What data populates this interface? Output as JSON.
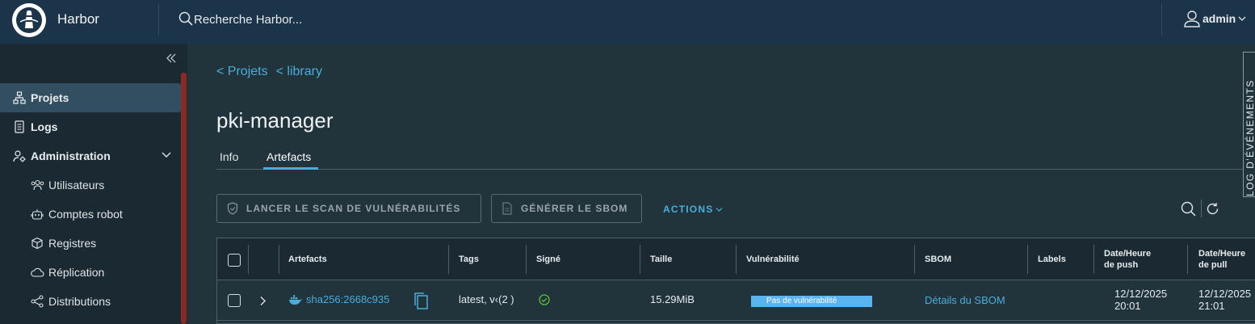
{
  "header": {
    "app_name": "Harbor",
    "search_placeholder": "Recherche Harbor...",
    "user": "admin"
  },
  "sidebar": {
    "items": [
      {
        "label": "Projets",
        "icon": "projects-icon",
        "active": true
      },
      {
        "label": "Logs",
        "icon": "logs-icon"
      },
      {
        "label": "Administration",
        "icon": "admin-icon",
        "expanded": true
      }
    ],
    "sub_items": [
      {
        "label": "Utilisateurs",
        "icon": "users-icon"
      },
      {
        "label": "Comptes robot",
        "icon": "robot-icon"
      },
      {
        "label": "Registres",
        "icon": "box-icon"
      },
      {
        "label": "Réplication",
        "icon": "cloud-icon"
      },
      {
        "label": "Distributions",
        "icon": "share-icon"
      }
    ]
  },
  "breadcrumb": [
    "< Projets",
    "< library"
  ],
  "page_title": "pki-manager",
  "tabs": [
    {
      "label": "Info"
    },
    {
      "label": "Artefacts",
      "active": true
    }
  ],
  "toolbar": {
    "scan_label": "LANCER LE SCAN DE VULNÉRABILITÉS",
    "sbom_label": "GÉNÉRER LE SBOM",
    "actions_label": "ACTIONS"
  },
  "table": {
    "columns": [
      "Artefacts",
      "Tags",
      "Signé",
      "Taille",
      "Vulnérabilité",
      "SBOM",
      "Labels",
      [
        "Date/Heure",
        "de push"
      ],
      [
        "Date/Heure",
        "de pull"
      ]
    ],
    "rows": [
      {
        "artifact": "sha256:2668c935",
        "tags": "latest, v‹(2 )",
        "signed": true,
        "size": "15.29MiB",
        "vulnerability": "Pas de vulnérabilité",
        "sbom": "Détails du SBOM",
        "labels": "",
        "push_time": [
          "12/12/2025",
          "20:01"
        ],
        "pull_time": [
          "12/12/2025",
          "21:01"
        ]
      }
    ]
  },
  "event_log_tab": "LOG D'ÉVÉNEMENTS",
  "colors": {
    "header_bg": "#1b3449",
    "sidebar_bg": "#1b2a32",
    "main_bg": "#21333b",
    "accent": "#4aaed9",
    "vuln_badge": "#5ab4f0",
    "success": "#5fbf3a"
  }
}
